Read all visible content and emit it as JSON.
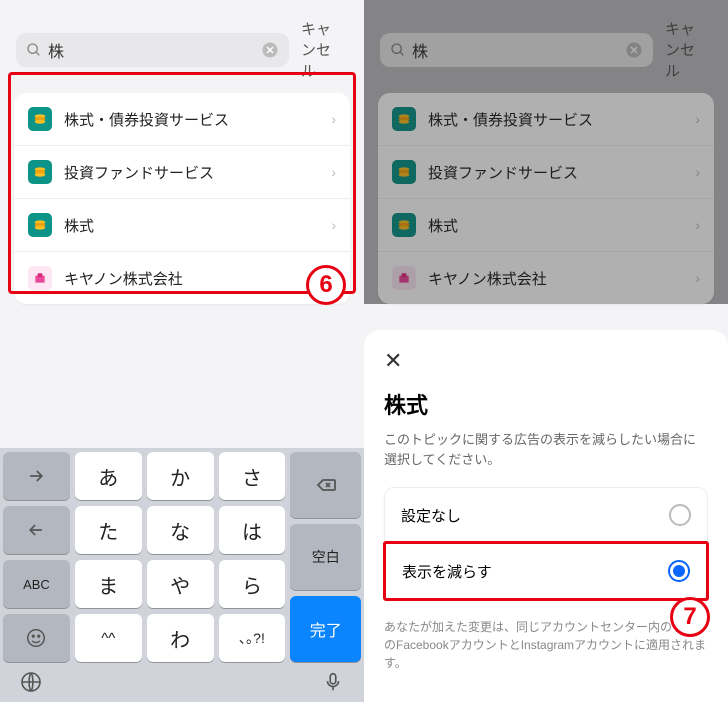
{
  "search": {
    "query": "株",
    "cancel": "キャンセル"
  },
  "results": [
    {
      "label": "株式・債券投資サービス",
      "icon": "teal"
    },
    {
      "label": "投資ファンドサービス",
      "icon": "teal"
    },
    {
      "label": "株式",
      "icon": "teal"
    },
    {
      "label": "キヤノン株式会社",
      "icon": "pink"
    }
  ],
  "annotations": {
    "step6": "6",
    "step7": "7"
  },
  "keyboard": {
    "rows": [
      [
        "→",
        "あ",
        "か",
        "さ"
      ],
      [
        "←",
        "た",
        "な",
        "は"
      ],
      [
        "ABC",
        "ま",
        "や",
        "ら"
      ],
      [
        "",
        "^^",
        "わ",
        "､｡?!"
      ]
    ],
    "right_col": [
      "⌫",
      "空白",
      "完了"
    ],
    "emoji": "☺",
    "globe": "🌐",
    "mic": "🎤"
  },
  "sheet": {
    "title": "株式",
    "desc": "このトピックに関する広告の表示を減らしたい場合に選択してください。",
    "option_none": "設定なし",
    "option_reduce": "表示を減らす",
    "footer": "あなたが加えた変更は、同じアカウントセンター内のすべてのFacebookアカウントとInstagramアカウントに適用されます。"
  }
}
